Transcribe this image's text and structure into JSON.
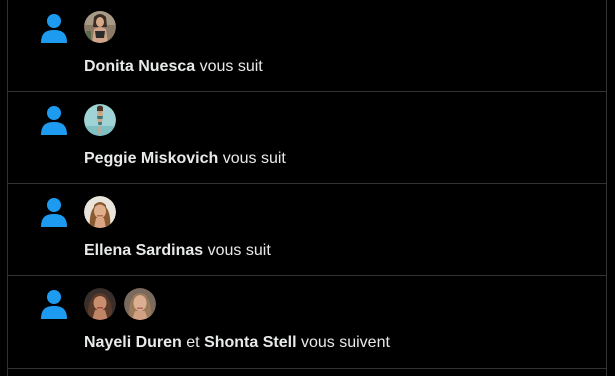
{
  "colors": {
    "background": "#000000",
    "divider": "#2f3336",
    "accent": "#1d9bf0",
    "text": "#e7e9ea"
  },
  "notifications": [
    {
      "icon": "person-icon",
      "users": [
        "Donita Nuesca"
      ],
      "action": "vous suit"
    },
    {
      "icon": "person-icon",
      "users": [
        "Peggie Miskovich"
      ],
      "action": "vous suit"
    },
    {
      "icon": "person-icon",
      "users": [
        "Ellena Sardinas"
      ],
      "action": "vous suit"
    },
    {
      "icon": "person-icon",
      "users": [
        "Nayeli Duren",
        "Shonta Stell"
      ],
      "conjunction": "et",
      "action": "vous suivent"
    }
  ]
}
